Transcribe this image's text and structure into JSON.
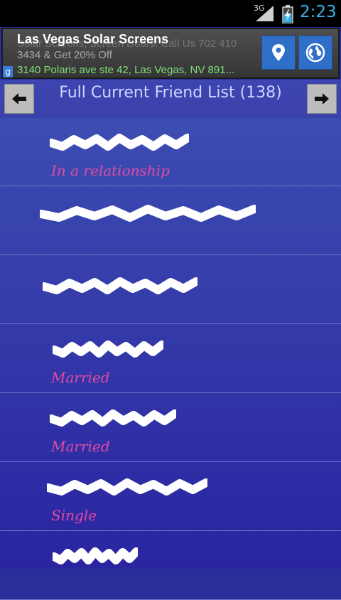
{
  "status_bar": {
    "network": "3G",
    "time": "2:23",
    "colors": {
      "bar": "#000000",
      "clock": "#36b3e6"
    }
  },
  "ad": {
    "title": "Las Vegas Solar Screens",
    "ghost_text": "Solar Screens, Screen Doors. Call Us 702 410",
    "description": "3434 & Get 20% Off",
    "address": "3140 Polaris ave ste 42, Las Vegas, NV 891...",
    "badge": "g",
    "buttons": [
      {
        "icon": "map-pin-icon"
      },
      {
        "icon": "globe-icon"
      }
    ]
  },
  "header": {
    "title": "Full Current Friend List (138)",
    "prev_icon": "arrow-left-icon",
    "next_icon": "arrow-right-icon"
  },
  "friends": [
    {
      "status": "In a relationship"
    },
    {
      "status": ""
    },
    {
      "status": ""
    },
    {
      "status": "Married"
    },
    {
      "status": "Married"
    },
    {
      "status": "Single"
    },
    {
      "status": ""
    }
  ],
  "colors": {
    "list_top": "#3c4db2",
    "list_bottom": "#2a24a0",
    "status_text": "#e44aa3",
    "divider": "#6e74c8"
  }
}
